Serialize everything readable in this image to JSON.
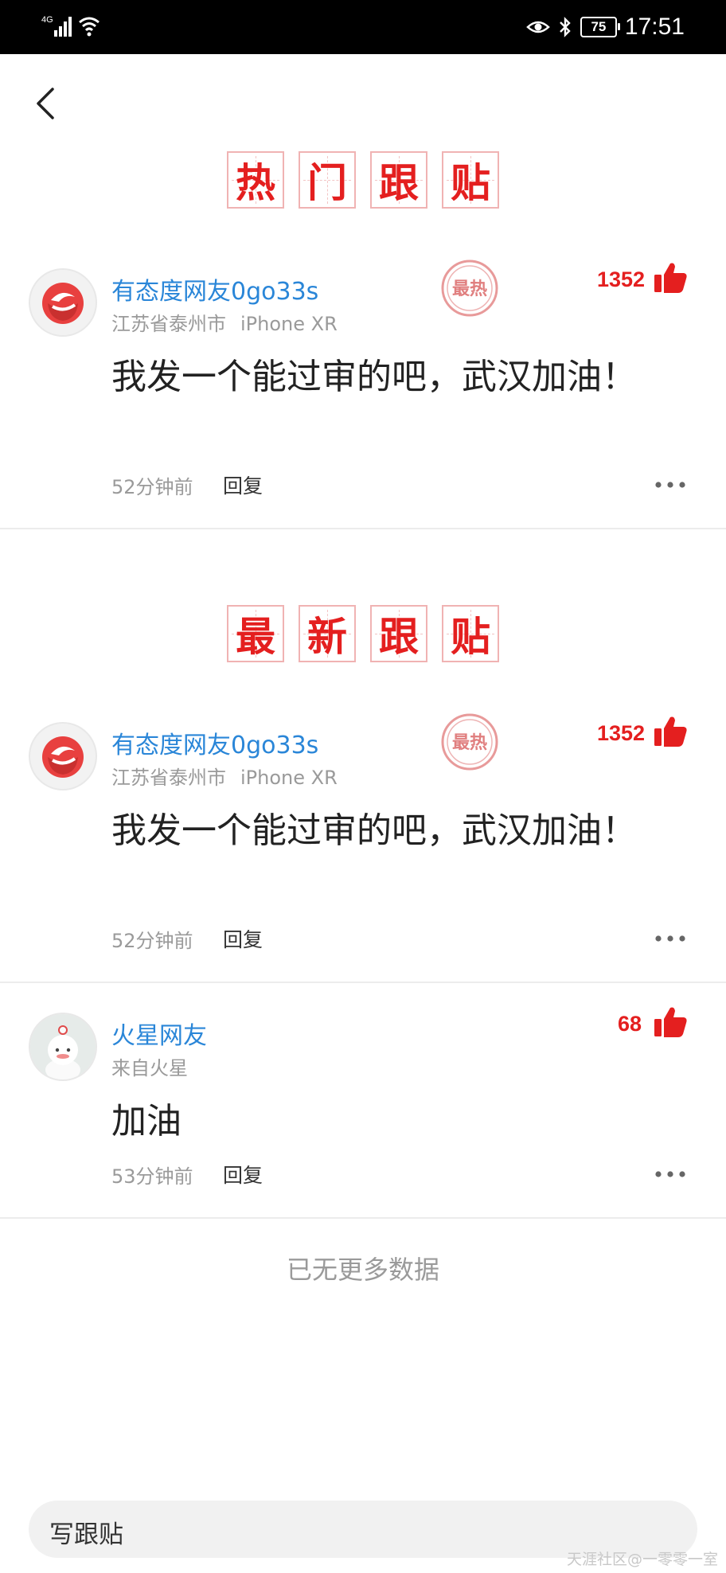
{
  "status_bar": {
    "network": "4G",
    "battery": "75",
    "time": "17:51"
  },
  "sections": {
    "hot_title": [
      "热",
      "门",
      "跟",
      "贴"
    ],
    "new_title": [
      "最",
      "新",
      "跟",
      "贴"
    ]
  },
  "hot_comments": [
    {
      "username": "有态度网友0go33s",
      "location": "江苏省泰州市",
      "device": "iPhone XR",
      "stamp": "最热",
      "likes": "1352",
      "content": "我发一个能过审的吧，武汉加油！",
      "time": "52分钟前",
      "reply_label": "回复"
    }
  ],
  "new_comments": [
    {
      "username": "有态度网友0go33s",
      "location": "江苏省泰州市",
      "device": "iPhone XR",
      "stamp": "最热",
      "likes": "1352",
      "content": "我发一个能过审的吧，武汉加油！",
      "time": "52分钟前",
      "reply_label": "回复"
    },
    {
      "username": "火星网友",
      "location": "来自火星",
      "device": "",
      "likes": "68",
      "content": "加油",
      "time": "53分钟前",
      "reply_label": "回复"
    }
  ],
  "no_more_text": "已无更多数据",
  "write_placeholder": "写跟贴",
  "watermark": "天涯社区@一零零一室",
  "colors": {
    "accent_red": "#e41f1f",
    "username_blue": "#2a86d8",
    "meta_gray": "#9a9a9a"
  },
  "icons": [
    "back-icon",
    "thumbs-up-icon",
    "more-icon",
    "signal-icon",
    "wifi-icon",
    "eye-icon",
    "bluetooth-icon",
    "battery-icon"
  ]
}
